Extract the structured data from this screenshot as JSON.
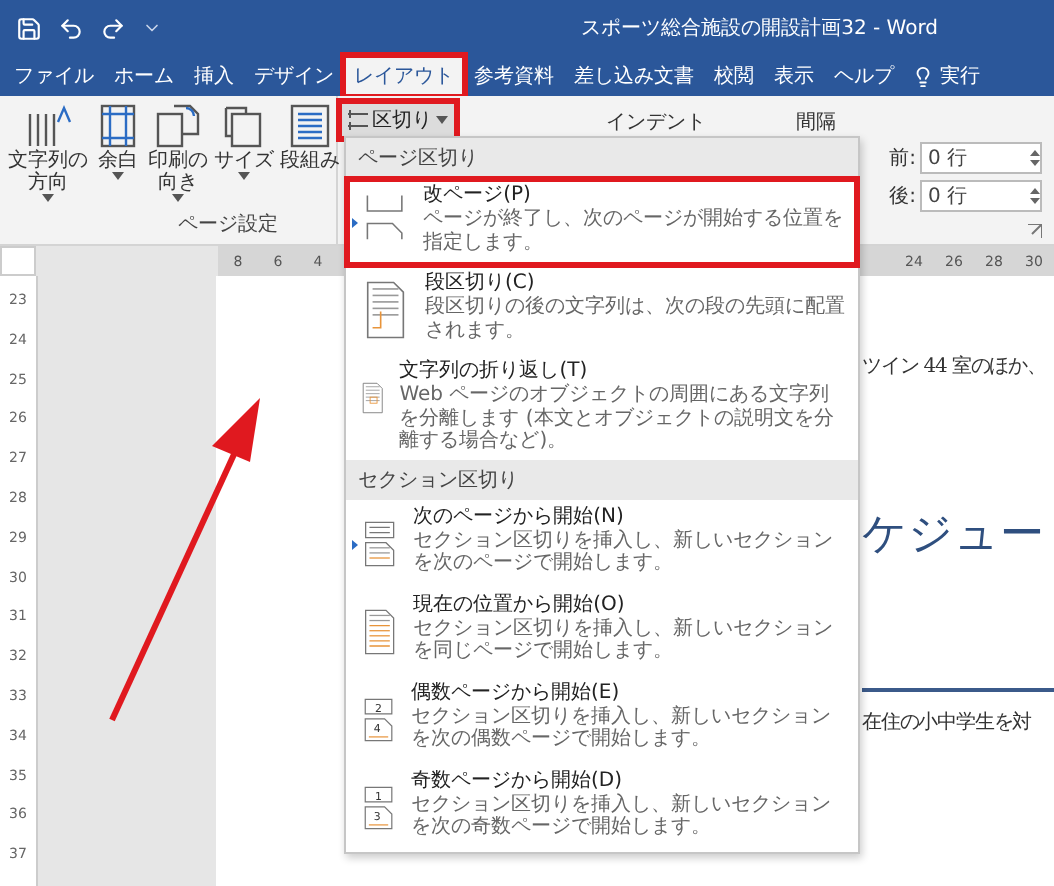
{
  "title_bar": {
    "title": "スポーツ総合施設の開設計画32 - Word"
  },
  "tabs": [
    {
      "label": "ファイル",
      "selected": false,
      "highlighted": false
    },
    {
      "label": "ホーム",
      "selected": false,
      "highlighted": false
    },
    {
      "label": "挿入",
      "selected": false,
      "highlighted": false
    },
    {
      "label": "デザイン",
      "selected": false,
      "highlighted": false
    },
    {
      "label": "レイアウト",
      "selected": true,
      "highlighted": true
    },
    {
      "label": "参考資料",
      "selected": false,
      "highlighted": false
    },
    {
      "label": "差し込み文書",
      "selected": false,
      "highlighted": false
    },
    {
      "label": "校閲",
      "selected": false,
      "highlighted": false
    },
    {
      "label": "表示",
      "selected": false,
      "highlighted": false
    },
    {
      "label": "ヘルプ",
      "selected": false,
      "highlighted": false
    }
  ],
  "tell_me": {
    "label": "実行"
  },
  "ribbon": {
    "buttons": [
      {
        "kind": "text-direction",
        "lines": [
          "文字列の",
          "方向"
        ],
        "dropdown": true
      },
      {
        "kind": "margins",
        "lines": [
          "余白"
        ],
        "dropdown": true
      },
      {
        "kind": "orientation",
        "lines": [
          "印刷の",
          "向き"
        ],
        "dropdown": true
      },
      {
        "kind": "size",
        "lines": [
          "サイズ"
        ],
        "dropdown": true
      },
      {
        "kind": "columns",
        "lines": [
          "段組み"
        ],
        "dropdown": false
      }
    ],
    "breaks_button": {
      "label": "区切り",
      "highlighted": true
    },
    "group_label": "ページ設定",
    "indent_label": "インデント",
    "spacing_label": "間隔",
    "spacing_fields": [
      {
        "label": "前:",
        "value": "0 行"
      },
      {
        "label": "後:",
        "value": "0 行"
      }
    ]
  },
  "ruler": {
    "left_numbers": [
      "8",
      "6",
      "4"
    ],
    "right_numbers": [
      "24",
      "26",
      "28",
      "30"
    ],
    "vertical_numbers": [
      "23",
      "24",
      "25",
      "26",
      "27",
      "28",
      "29",
      "30",
      "31",
      "32",
      "33",
      "34",
      "35",
      "36",
      "37"
    ]
  },
  "menu": {
    "sections": [
      {
        "header": "ページ区切り",
        "items": [
          {
            "kind": "page-break",
            "title": "改ページ(P)",
            "description": "ページが終了し、次のページが開始する位置を指定します。",
            "highlighted": true,
            "default": true
          },
          {
            "kind": "column",
            "title": "段区切り(C)",
            "description": "段区切りの後の文字列は、次の段の先頭に配置されます。",
            "highlighted": false,
            "default": false
          },
          {
            "kind": "text-wrap",
            "title": "文字列の折り返し(T)",
            "description": "Web ページのオブジェクトの周囲にある文字列を分離します (本文とオブジェクトの説明文を分離する場合など)。",
            "highlighted": false,
            "default": false
          }
        ]
      },
      {
        "header": "セクション区切り",
        "items": [
          {
            "kind": "next-page",
            "title": "次のページから開始(N)",
            "description": "セクション区切りを挿入し、新しいセクションを次のページで開始します。",
            "highlighted": false,
            "default": true
          },
          {
            "kind": "continuous",
            "title": "現在の位置から開始(O)",
            "description": "セクション区切りを挿入し、新しいセクションを同じページで開始します。",
            "highlighted": false,
            "default": false
          },
          {
            "kind": "numbered",
            "numbers": [
              "2",
              "4"
            ],
            "title": "偶数ページから開始(E)",
            "description": "セクション区切りを挿入し、新しいセクションを次の偶数ページで開始します。",
            "highlighted": false,
            "default": false
          },
          {
            "kind": "numbered",
            "numbers": [
              "1",
              "3"
            ],
            "title": "奇数ページから開始(D)",
            "description": "セクション区切りを挿入し、新しいセクションを次の奇数ページで開始します。",
            "highlighted": false,
            "default": false
          }
        ]
      }
    ]
  },
  "document": {
    "blocks": [
      {
        "kind": "text",
        "text": "ツイン 44 室のほか、"
      },
      {
        "kind": "heading",
        "text": "ケジュー"
      },
      {
        "kind": "rule"
      },
      {
        "kind": "text",
        "text": "在住の小中学生を対"
      }
    ]
  },
  "annotations": [
    {
      "kind": "arrow"
    }
  ]
}
